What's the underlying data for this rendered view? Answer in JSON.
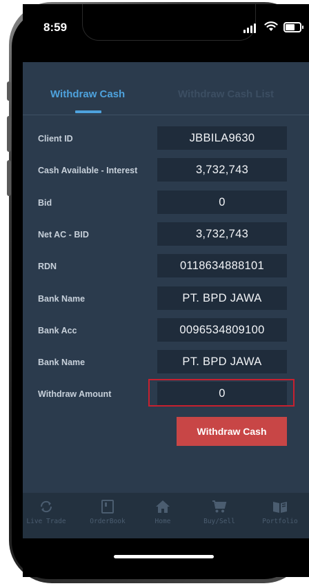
{
  "status_bar": {
    "time": "8:59",
    "icons": [
      "signal-icon",
      "wifi-icon",
      "battery-icon"
    ]
  },
  "tabs": [
    {
      "label": "Withdraw Cash",
      "active": true
    },
    {
      "label": "Withdraw Cash List",
      "active": false
    }
  ],
  "form": {
    "rows": [
      {
        "label": "Client ID",
        "value": "JBBILA9630"
      },
      {
        "label": "Cash Available - Interest",
        "value": "3,732,743"
      },
      {
        "label": "Bid",
        "value": "0"
      },
      {
        "label": "Net AC - BID",
        "value": "3,732,743"
      },
      {
        "label": "RDN",
        "value": "0118634888101"
      },
      {
        "label": "Bank Name",
        "value": "PT. BPD JAWA"
      },
      {
        "label": "Bank Acc",
        "value": "0096534809100"
      },
      {
        "label": "Bank Name",
        "value": "PT. BPD JAWA"
      }
    ],
    "withdraw_amount": {
      "label": "Withdraw Amount",
      "value": "0"
    },
    "submit_label": "Withdraw Cash"
  },
  "bottom_nav": [
    {
      "label": "Live Trade",
      "icon": "refresh-icon"
    },
    {
      "label": "OrderBook",
      "icon": "book-icon"
    },
    {
      "label": "Home",
      "icon": "home-icon"
    },
    {
      "label": "Buy/Sell",
      "icon": "cart-icon"
    },
    {
      "label": "Portfolio",
      "icon": "portfolio-book-icon"
    }
  ],
  "colors": {
    "panel_bg": "#2b3b4d",
    "field_bg": "#1f2c3b",
    "accent_blue": "#4ea2dd",
    "button_red": "#c84646",
    "highlight_red": "#c8202f"
  }
}
